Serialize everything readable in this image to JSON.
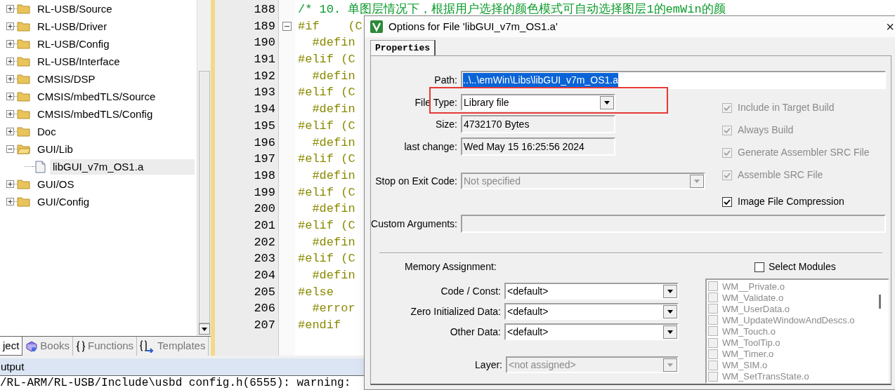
{
  "project_tree": {
    "items": [
      {
        "label": "RL-USB/Source",
        "kind": "folder",
        "expanded": false,
        "selected": false
      },
      {
        "label": "RL-USB/Driver",
        "kind": "folder",
        "expanded": false,
        "selected": false
      },
      {
        "label": "RL-USB/Config",
        "kind": "folder",
        "expanded": false,
        "selected": false
      },
      {
        "label": "RL-USB/Interface",
        "kind": "folder",
        "expanded": false,
        "selected": false
      },
      {
        "label": "CMSIS/DSP",
        "kind": "folder",
        "expanded": false,
        "selected": false
      },
      {
        "label": "CMSIS/mbedTLS/Source",
        "kind": "folder",
        "expanded": false,
        "selected": false
      },
      {
        "label": "CMSIS/mbedTLS/Config",
        "kind": "folder",
        "expanded": false,
        "selected": false
      },
      {
        "label": "Doc",
        "kind": "folder",
        "expanded": false,
        "selected": false
      },
      {
        "label": "GUI/Lib",
        "kind": "folder",
        "expanded": true,
        "selected": false,
        "children": [
          {
            "label": "libGUI_v7m_OS1.a",
            "kind": "file",
            "selected": true
          }
        ]
      },
      {
        "label": "GUI/OS",
        "kind": "folder",
        "expanded": false,
        "selected": false
      },
      {
        "label": "GUI/Config",
        "kind": "folder",
        "expanded": false,
        "selected": false
      }
    ]
  },
  "panel_tabs": [
    {
      "label": "ject",
      "kind": "project",
      "selected": true
    },
    {
      "label": "Books",
      "kind": "books",
      "selected": false
    },
    {
      "label": "Functions",
      "kind": "functions",
      "selected": false
    },
    {
      "label": "Templates",
      "kind": "templates",
      "selected": false
    }
  ],
  "editor": {
    "lines": [
      {
        "number": "188",
        "text": "/* 10. 单图层情况下，根据用户选择的颜色模式可自动选择图层1的emWin的颜",
        "kind": "comment",
        "foldable": false
      },
      {
        "number": "189",
        "text": "#if    (C",
        "kind": "directive",
        "foldable": true
      },
      {
        "number": "190",
        "text": "  #defin",
        "kind": "directive",
        "foldable": false
      },
      {
        "number": "191",
        "text": "#elif (C",
        "kind": "directive",
        "foldable": false
      },
      {
        "number": "192",
        "text": "  #defin",
        "kind": "directive",
        "foldable": false
      },
      {
        "number": "193",
        "text": "#elif (C",
        "kind": "directive",
        "foldable": false
      },
      {
        "number": "194",
        "text": "  #defin",
        "kind": "directive",
        "foldable": false
      },
      {
        "number": "195",
        "text": "#elif (C",
        "kind": "directive",
        "foldable": false
      },
      {
        "number": "196",
        "text": "  #defin",
        "kind": "directive",
        "foldable": false
      },
      {
        "number": "197",
        "text": "#elif (C",
        "kind": "directive",
        "foldable": false
      },
      {
        "number": "198",
        "text": "  #defin",
        "kind": "directive",
        "foldable": false
      },
      {
        "number": "199",
        "text": "#elif (C",
        "kind": "directive",
        "foldable": false
      },
      {
        "number": "200",
        "text": "  #defin",
        "kind": "directive",
        "foldable": false
      },
      {
        "number": "201",
        "text": "#elif (C",
        "kind": "directive",
        "foldable": false
      },
      {
        "number": "202",
        "text": "  #defin",
        "kind": "directive",
        "foldable": false
      },
      {
        "number": "203",
        "text": "#elif (C",
        "kind": "directive",
        "foldable": false
      },
      {
        "number": "204",
        "text": "  #defin",
        "kind": "directive",
        "foldable": false
      },
      {
        "number": "205",
        "text": "#else",
        "kind": "directive",
        "foldable": false
      },
      {
        "number": "206",
        "text": "  #error",
        "kind": "directive",
        "foldable": false
      },
      {
        "number": "207",
        "text": "#endif",
        "kind": "directive",
        "foldable": false
      }
    ]
  },
  "output": {
    "title": "utput",
    "lines": [
      "/RL-ARM/RL-USB/Include\\usbd config.h(6555): warning:"
    ]
  },
  "dialog": {
    "title": "Options for File 'libGUI_v7m_OS1.a'",
    "close": "×",
    "tabs": [
      {
        "label": "Properties",
        "selected": true
      }
    ],
    "path": {
      "label": "Path:",
      "value": "..\\..\\emWin\\Libs\\libGUI_v7m_OS1.a",
      "value_selected": true
    },
    "file_type": {
      "label": "File Type:",
      "value": "Library file"
    },
    "size": {
      "label": "Size:",
      "value": "4732170 Bytes"
    },
    "last_change": {
      "label": "last change:",
      "value": "Wed May 15 16:25:56 2024"
    },
    "stop_on_exit": {
      "label": "Stop on Exit Code:",
      "value": "Not specified",
      "disabled": true
    },
    "custom_arguments": {
      "label": "Custom Arguments:"
    },
    "options": [
      {
        "label": "Include in Target Build",
        "checked": true,
        "disabled": true
      },
      {
        "label": "Always Build",
        "checked": true,
        "disabled": true
      },
      {
        "label": "Generate Assembler SRC File",
        "checked": true,
        "disabled": true
      },
      {
        "label": "Assemble SRC File",
        "checked": true,
        "disabled": true
      },
      {
        "label": "Image File Compression",
        "checked": true,
        "disabled": false
      }
    ],
    "memory_assignment": {
      "title": "Memory Assignment:",
      "fields": [
        {
          "label": "Code / Const:",
          "value": "<default>",
          "disabled": false
        },
        {
          "label": "Zero Initialized Data:",
          "value": "<default>",
          "disabled": false
        },
        {
          "label": "Other Data:",
          "value": "<default>",
          "disabled": false
        }
      ],
      "layer": {
        "label": "Layer:",
        "value": "<not assigned>",
        "disabled": true
      }
    },
    "select_modules": {
      "label": "Select Modules",
      "checked": false
    },
    "modules": [
      {
        "label": "WM__Private.o",
        "checked": false,
        "disabled": true
      },
      {
        "label": "WM_Validate.o",
        "checked": false,
        "disabled": true
      },
      {
        "label": "WM_UserData.o",
        "checked": false,
        "disabled": true
      },
      {
        "label": "WM_UpdateWindowAndDescs.o",
        "checked": false,
        "disabled": true
      },
      {
        "label": "WM_Touch.o",
        "checked": false,
        "disabled": true
      },
      {
        "label": "WM_ToolTip.o",
        "checked": false,
        "disabled": true
      },
      {
        "label": "WM_Timer.o",
        "checked": false,
        "disabled": true
      },
      {
        "label": "WM_SIM.o",
        "checked": false,
        "disabled": true
      },
      {
        "label": "WM_SetTransState.o",
        "checked": false,
        "disabled": true
      }
    ]
  }
}
